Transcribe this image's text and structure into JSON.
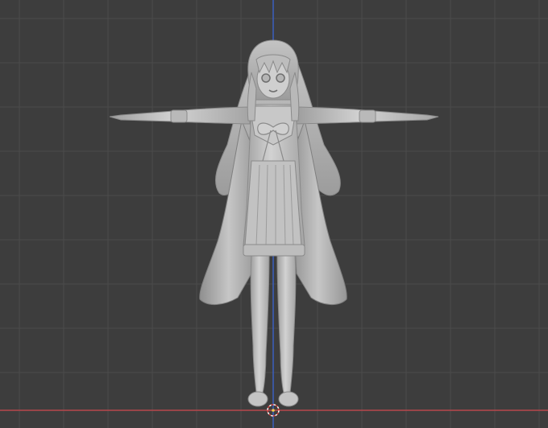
{
  "viewport": {
    "background": "#3d3d3d",
    "grid_color": "#4b4b4b",
    "x_axis_color": "#b8474d",
    "z_axis_color": "#3b5fbf"
  },
  "scene": {
    "object": "character-mesh",
    "material_color": "#c9c9c9",
    "pose": "t-pose",
    "origin_marker": "3d-cursor-icon"
  }
}
